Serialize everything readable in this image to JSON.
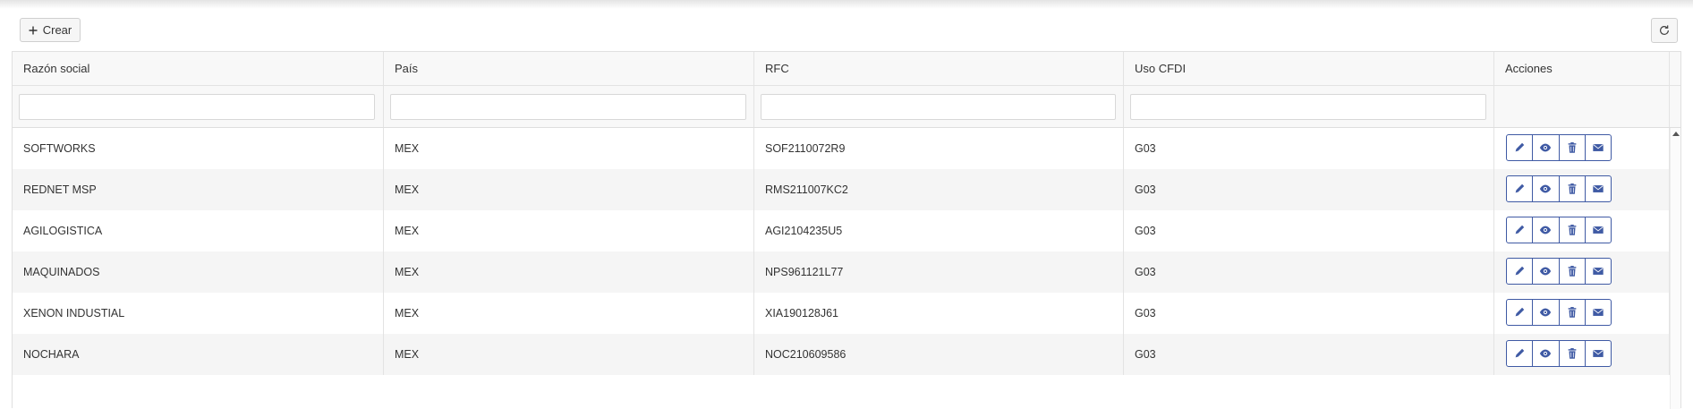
{
  "toolbar": {
    "create_label": "Crear"
  },
  "columns": [
    "Razón social",
    "País",
    "RFC",
    "Uso CFDI",
    "Acciones"
  ],
  "rows": [
    {
      "razon": "SOFTWORKS",
      "pais": "MEX",
      "rfc": "SOF2110072R9",
      "uso": "G03"
    },
    {
      "razon": "REDNET MSP",
      "pais": "MEX",
      "rfc": "RMS211007KC2",
      "uso": "G03"
    },
    {
      "razon": "AGILOGISTICA",
      "pais": "MEX",
      "rfc": "AGI2104235U5",
      "uso": "G03"
    },
    {
      "razon": "MAQUINADOS",
      "pais": "MEX",
      "rfc": "NPS961121L77",
      "uso": "G03"
    },
    {
      "razon": "XENON INDUSTIAL",
      "pais": "MEX",
      "rfc": "XIA190128J61",
      "uso": "G03"
    },
    {
      "razon": "NOCHARA",
      "pais": "MEX",
      "rfc": "NOC210609586",
      "uso": "G03"
    }
  ],
  "filters": {
    "razon": "",
    "pais": "",
    "rfc": "",
    "uso": ""
  },
  "icons": {
    "create": "plus-icon",
    "refresh": "refresh-icon",
    "edit": "pencil-icon",
    "view": "eye-icon",
    "delete": "trash-icon",
    "email": "envelope-icon"
  },
  "colors": {
    "accent": "#3f5aa4"
  }
}
